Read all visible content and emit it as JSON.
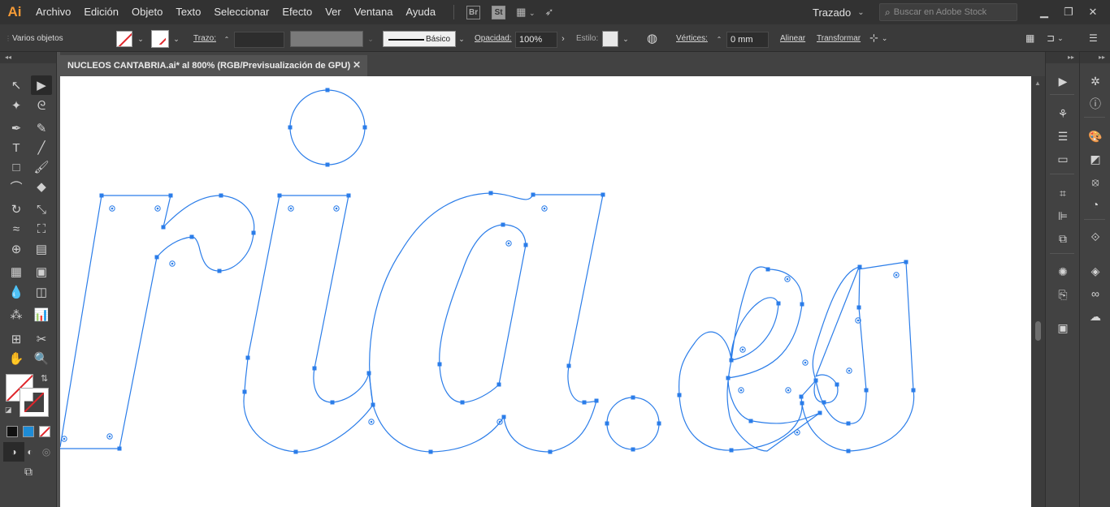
{
  "app": {
    "logo": "Ai"
  },
  "menu": [
    "Archivo",
    "Edición",
    "Objeto",
    "Texto",
    "Seleccionar",
    "Efecto",
    "Ver",
    "Ventana",
    "Ayuda"
  ],
  "bridge_label": "Br",
  "stock_label": "St",
  "workspace": {
    "label": "Trazado"
  },
  "stock_search": {
    "placeholder": "Buscar en Adobe Stock"
  },
  "control": {
    "selection_label": "Varios objetos",
    "stroke_label": "Trazo:",
    "profile_label": "Básico",
    "opacity_label": "Opacidad:",
    "opacity_value": "100%",
    "style_label": "Estilo:",
    "vertices_label": "Vértices:",
    "vertices_value": "0 mm",
    "align_label": "Alinear",
    "transform_label": "Transformar"
  },
  "document": {
    "tab_title": "NUCLEOS CANTABRIA.ai* al 800% (RGB/Previsualización de GPU)"
  },
  "colors": {
    "path_blue": "#2b7de9",
    "fill_none_red": "#e0262b",
    "menu_bg": "#323232",
    "panel_bg": "#424242",
    "canvas_bg": "#ffffff",
    "accent_orange": "#f49a36"
  },
  "icons": {
    "tools": [
      "selection-icon",
      "direct-selection-icon",
      "magic-wand-icon",
      "lasso-icon",
      "pen-icon",
      "curvature-icon",
      "type-icon",
      "line-icon",
      "rectangle-icon",
      "paintbrush-icon",
      "shaper-icon",
      "eraser-icon",
      "rotate-icon",
      "scale-icon",
      "width-icon",
      "free-transform-icon",
      "shape-builder-icon",
      "perspective-grid-icon",
      "mesh-icon",
      "gradient-icon",
      "eyedropper-icon",
      "blend-icon",
      "symbol-sprayer-icon",
      "graph-icon",
      "artboard-icon",
      "slice-icon",
      "hand-icon",
      "zoom-icon"
    ],
    "right_panel": [
      "play-icon",
      "properties-icon",
      "libraries-icon",
      "info-icon",
      "align-icon",
      "layers-icon"
    ]
  }
}
